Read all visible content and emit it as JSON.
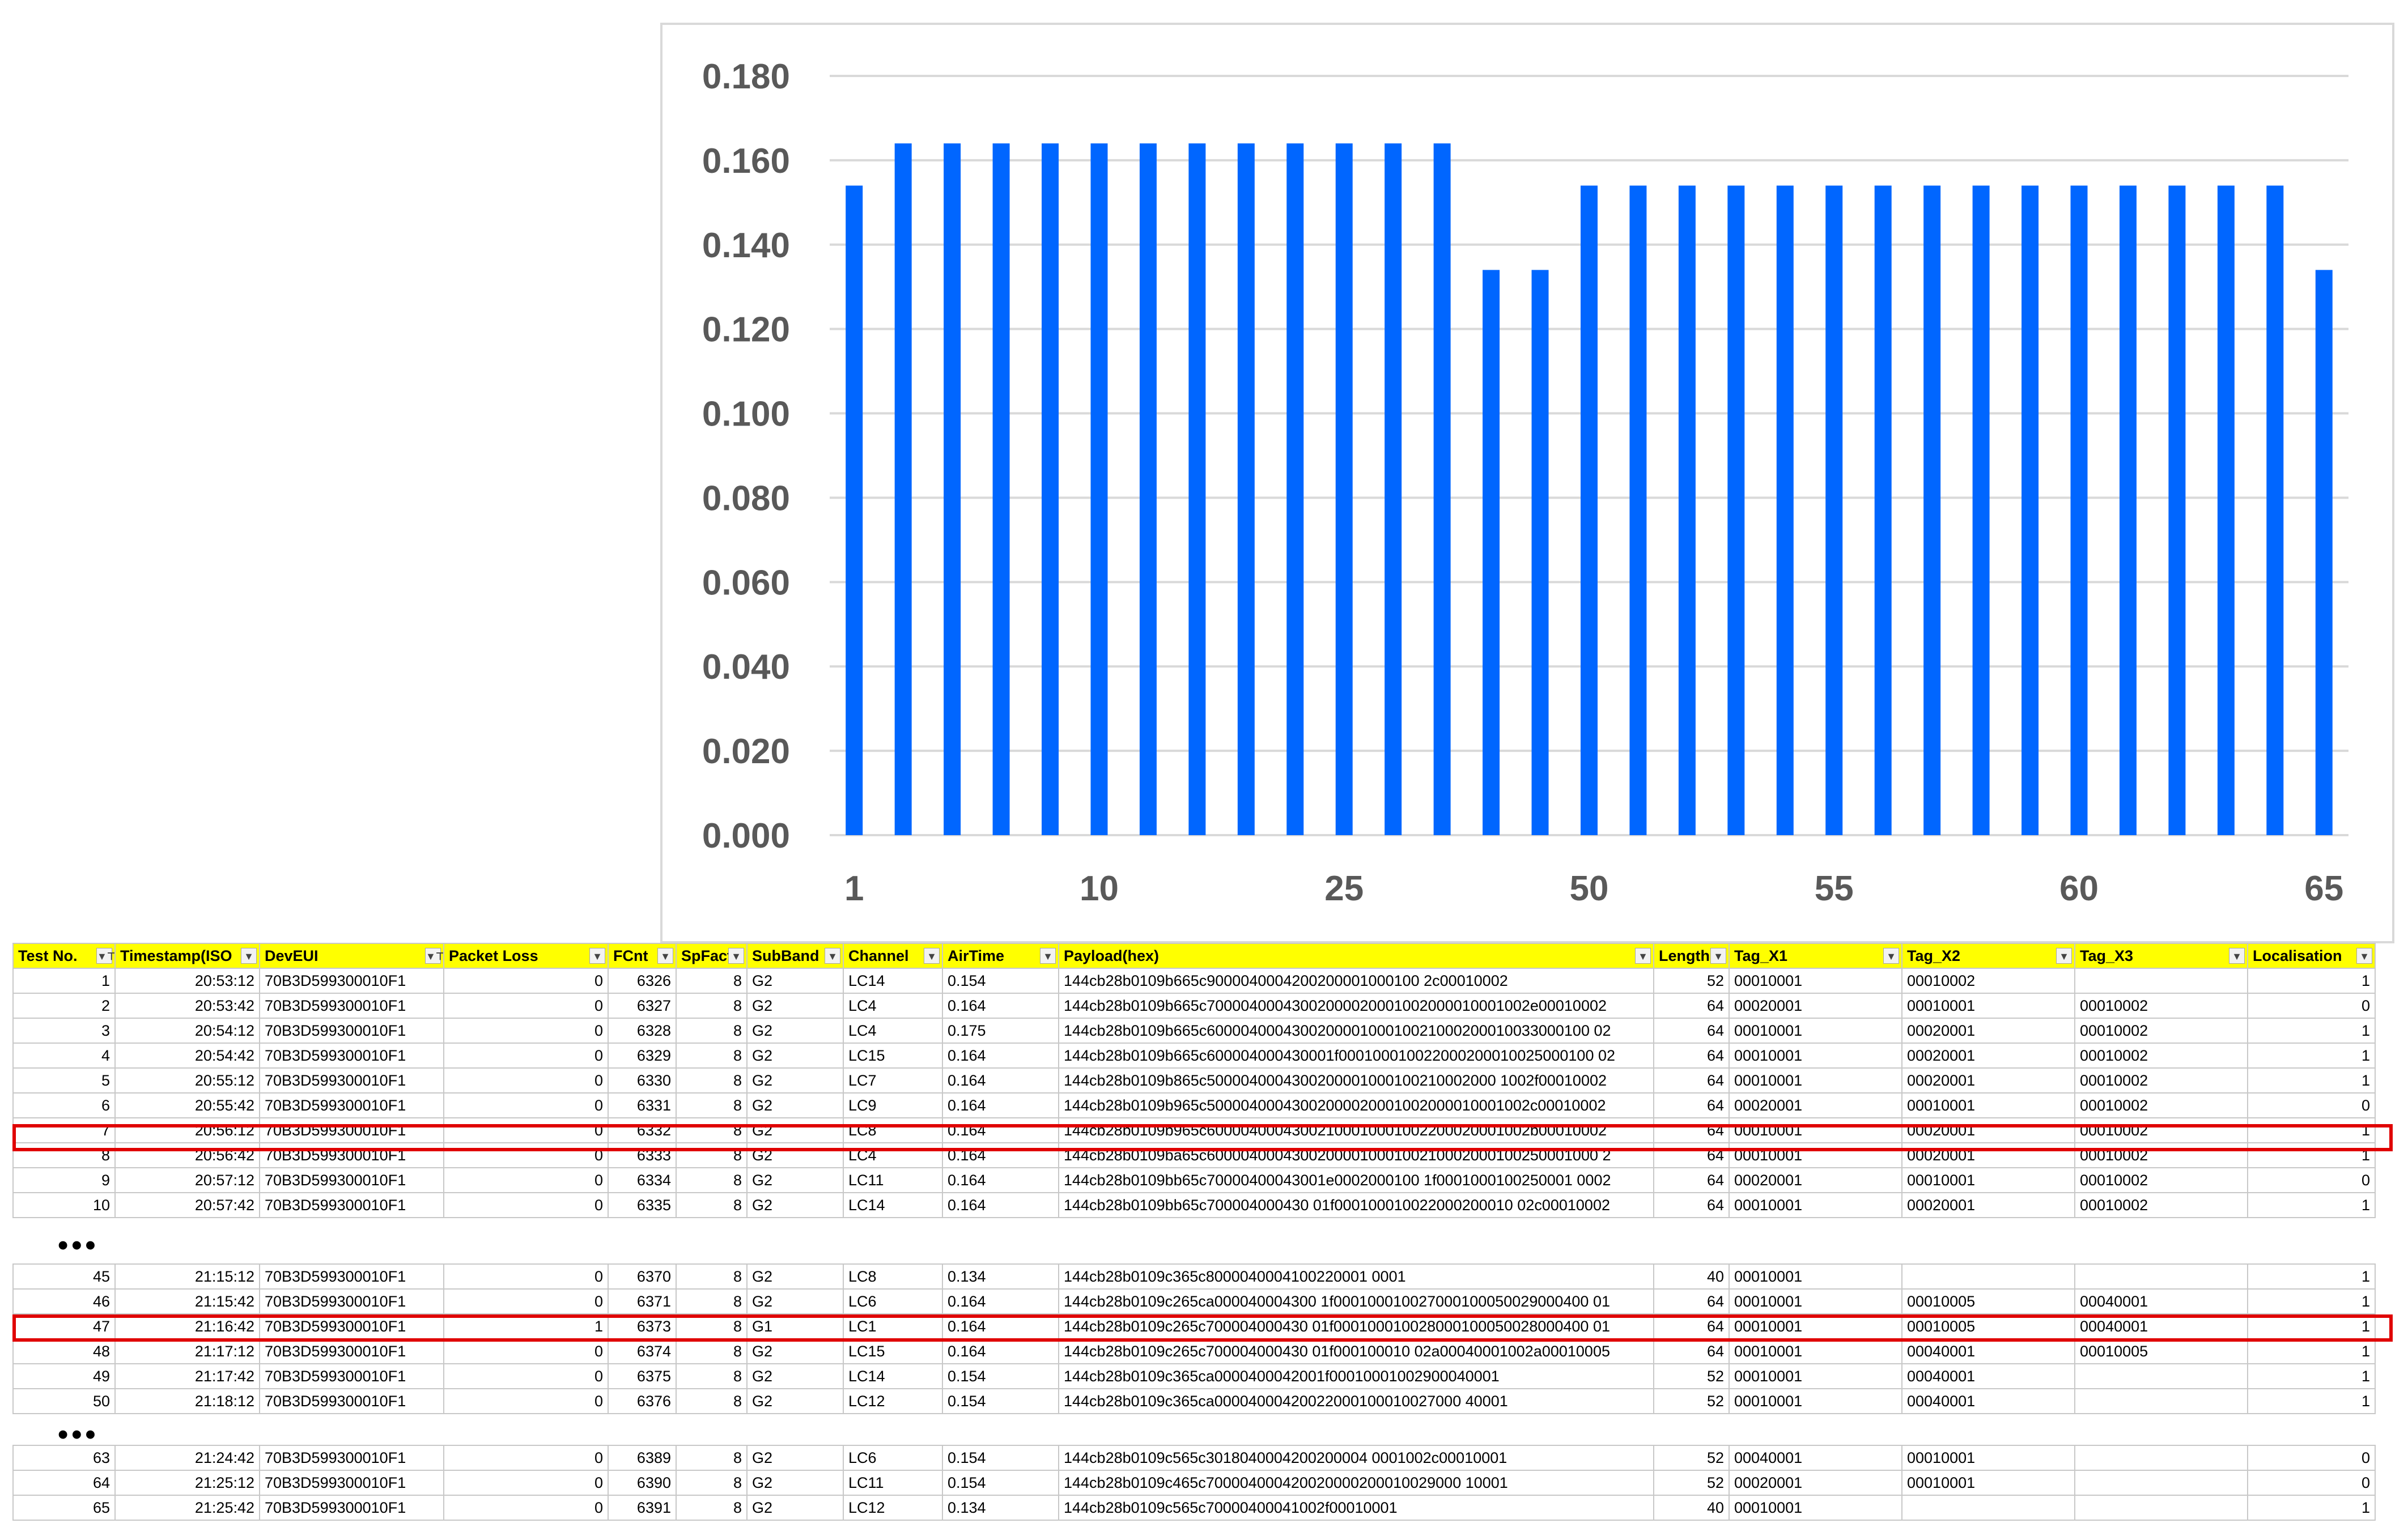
{
  "chart_data": {
    "type": "bar",
    "x_tick_labels": [
      "1",
      "10",
      "25",
      "50",
      "55",
      "60",
      "65"
    ],
    "y_tick_labels": [
      "0.000",
      "0.020",
      "0.040",
      "0.060",
      "0.080",
      "0.100",
      "0.120",
      "0.140",
      "0.160",
      "0.180"
    ],
    "ylim": [
      0,
      0.18
    ],
    "grid": true,
    "bar_color": "#0066ff",
    "values": [
      0.154,
      0.164,
      0.164,
      0.164,
      0.164,
      0.164,
      0.164,
      0.164,
      0.164,
      0.164,
      0.164,
      0.164,
      0.164,
      0.134,
      0.134,
      0.154,
      0.154,
      0.154,
      0.154,
      0.154,
      0.154,
      0.154,
      0.154,
      0.154,
      0.154,
      0.154,
      0.154,
      0.154,
      0.154,
      0.154,
      0.134
    ]
  },
  "table": {
    "headers": [
      "Test No.",
      "Timestamp(ISO",
      "DevEUI",
      "Packet Loss",
      "FCnt",
      "SpFact",
      "SubBand",
      "Channel",
      "AirTime",
      "Payload(hex)",
      "Length",
      "Tag_X1",
      "Tag_X2",
      "Tag_X3",
      "Localisation"
    ],
    "filter_glyphs": [
      "▼⊤",
      "▼",
      "▼⊤",
      "▼",
      "▼",
      "▼",
      "▼",
      "▼",
      "▼",
      "▼",
      "▼",
      "▼",
      "▼",
      "▼",
      "▼"
    ],
    "ellipsis": "•••",
    "groups": [
      [
        [
          "1",
          "20:53:12",
          "70B3D599300010F1",
          "0",
          "6326",
          "8",
          "G2",
          "LC14",
          "0.154",
          "144cb28b0109b665c9000040004200200001000100 2c00010002",
          "52",
          "00010001",
          "00010002",
          "",
          "1"
        ],
        [
          "2",
          "20:53:42",
          "70B3D599300010F1",
          "0",
          "6327",
          "8",
          "G2",
          "LC4",
          "0.164",
          "144cb28b0109b665c70000400043002000020001002000010001002e00010002",
          "64",
          "00020001",
          "00010001",
          "00010002",
          "0"
        ],
        [
          "3",
          "20:54:12",
          "70B3D599300010F1",
          "0",
          "6328",
          "8",
          "G2",
          "LC4",
          "0.175",
          "144cb28b0109b665c600004000430020000100010021000200010033000100 02",
          "64",
          "00010001",
          "00020001",
          "00010002",
          "1"
        ],
        [
          "4",
          "20:54:42",
          "70B3D599300010F1",
          "0",
          "6329",
          "8",
          "G2",
          "LC15",
          "0.164",
          "144cb28b0109b665c600004000430001f000100010022000200010025000100 02",
          "64",
          "00010001",
          "00020001",
          "00010002",
          "1"
        ],
        [
          "5",
          "20:55:12",
          "70B3D599300010F1",
          "0",
          "6330",
          "8",
          "G2",
          "LC7",
          "0.164",
          "144cb28b0109b865c5000040004300200001000100210002000 1002f00010002",
          "64",
          "00010001",
          "00020001",
          "00010002",
          "1"
        ],
        [
          "6",
          "20:55:42",
          "70B3D599300010F1",
          "0",
          "6331",
          "8",
          "G2",
          "LC9",
          "0.164",
          "144cb28b0109b965c50000400043002000020001002000010001002c00010002",
          "64",
          "00020001",
          "00010001",
          "00010002",
          "0"
        ],
        [
          "7",
          "20:56:12",
          "70B3D599300010F1",
          "0",
          "6332",
          "8",
          "G2",
          "LC8",
          "0.164",
          "144cb28b0109b965c60000400043002100010001002200020001002b00010002",
          "64",
          "00010001",
          "00020001",
          "00010002",
          "1"
        ],
        [
          "8",
          "20:56:42",
          "70B3D599300010F1",
          "0",
          "6333",
          "8",
          "G2",
          "LC4",
          "0.164",
          "144cb28b0109ba65c6000040004300200001000100210002000100250001000 2",
          "64",
          "00010001",
          "00020001",
          "00010002",
          "1"
        ],
        [
          "9",
          "20:57:12",
          "70B3D599300010F1",
          "0",
          "6334",
          "8",
          "G2",
          "LC11",
          "0.164",
          "144cb28b0109bb65c70000400043001e0002000100 1f0001000100250001 0002",
          "64",
          "00020001",
          "00010001",
          "00010002",
          "0"
        ],
        [
          "10",
          "20:57:42",
          "70B3D599300010F1",
          "0",
          "6335",
          "8",
          "G2",
          "LC14",
          "0.164",
          "144cb28b0109bb65c700004000430 01f000100010022000200010 02c00010002",
          "64",
          "00010001",
          "00020001",
          "00010002",
          "1"
        ]
      ],
      [
        [
          "45",
          "21:15:12",
          "70B3D599300010F1",
          "0",
          "6370",
          "8",
          "G2",
          "LC8",
          "0.134",
          "144cb28b0109c365c8000040004100220001 0001",
          "40",
          "00010001",
          "",
          "",
          "1"
        ],
        [
          "46",
          "21:15:42",
          "70B3D599300010F1",
          "0",
          "6371",
          "8",
          "G2",
          "LC6",
          "0.164",
          "144cb28b0109c265ca000040004300 1f000100010027000100050029000400 01",
          "64",
          "00010001",
          "00010005",
          "00040001",
          "1"
        ],
        [
          "47",
          "21:16:42",
          "70B3D599300010F1",
          "1",
          "6373",
          "8",
          "G1",
          "LC1",
          "0.164",
          "144cb28b0109c265c700004000430 01f000100010028000100050028000400 01",
          "64",
          "00010001",
          "00010005",
          "00040001",
          "1"
        ],
        [
          "48",
          "21:17:12",
          "70B3D599300010F1",
          "0",
          "6374",
          "8",
          "G2",
          "LC15",
          "0.164",
          "144cb28b0109c265c700004000430 01f000100010 02a00040001002a00010005",
          "64",
          "00010001",
          "00040001",
          "00010005",
          "1"
        ],
        [
          "49",
          "21:17:42",
          "70B3D599300010F1",
          "0",
          "6375",
          "8",
          "G2",
          "LC14",
          "0.154",
          "144cb28b0109c365ca0000400042001f00010001002900040001",
          "52",
          "00010001",
          "00040001",
          "",
          "1"
        ],
        [
          "50",
          "21:18:12",
          "70B3D599300010F1",
          "0",
          "6376",
          "8",
          "G2",
          "LC12",
          "0.154",
          "144cb28b0109c365ca00004000420022000100010027000 40001",
          "52",
          "00010001",
          "00040001",
          "",
          "1"
        ]
      ],
      [
        [
          "63",
          "21:24:42",
          "70B3D599300010F1",
          "0",
          "6389",
          "8",
          "G2",
          "LC6",
          "0.154",
          "144cb28b0109c565c3018040004200200004 0001002c00010001",
          "52",
          "00040001",
          "00010001",
          "",
          "0"
        ],
        [
          "64",
          "21:25:12",
          "70B3D599300010F1",
          "0",
          "6390",
          "8",
          "G2",
          "LC11",
          "0.154",
          "144cb28b0109c465c700004000420020000200010029000 10001",
          "52",
          "00020001",
          "00010001",
          "",
          "0"
        ],
        [
          "65",
          "21:25:42",
          "70B3D599300010F1",
          "0",
          "6391",
          "8",
          "G2",
          "LC12",
          "0.134",
          "144cb28b0109c565c70000400041002f00010001",
          "40",
          "00010001",
          "",
          "",
          "1"
        ]
      ]
    ]
  }
}
